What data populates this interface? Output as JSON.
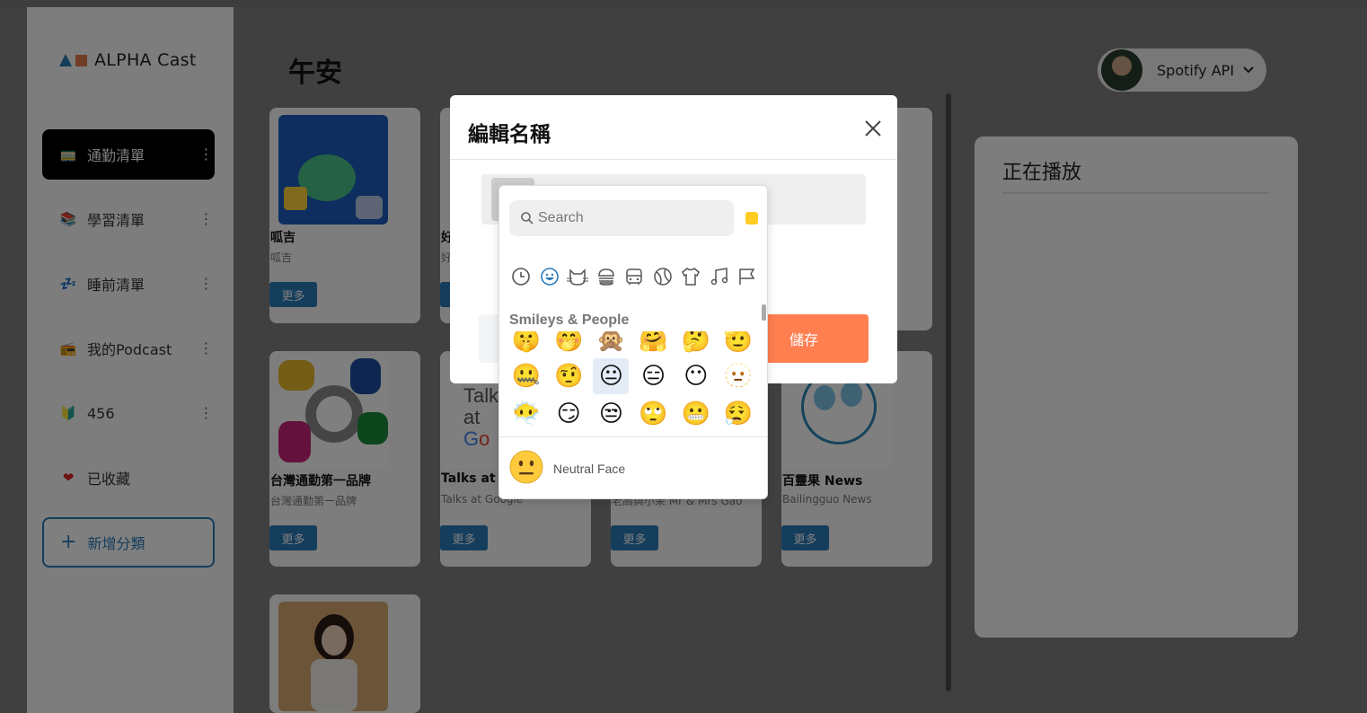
{
  "app": {
    "logo_text": "ALPHA Cast",
    "greeting": "午安"
  },
  "sidebar": {
    "items": [
      {
        "label": "通勤清單",
        "icon": "bus-icon",
        "glyph": "🚃",
        "active": true
      },
      {
        "label": "學習清單",
        "icon": "books-icon",
        "glyph": "📚",
        "active": false
      },
      {
        "label": "睡前清單",
        "icon": "sleep-icon",
        "glyph": "💤",
        "active": false
      },
      {
        "label": "我的Podcast",
        "icon": "radio-icon",
        "glyph": "📻",
        "active": false
      },
      {
        "label": "456",
        "icon": "beginner-icon",
        "glyph": "🔰",
        "active": false
      },
      {
        "label": "已收藏",
        "icon": "heart-icon",
        "glyph": "❤",
        "active": false
      }
    ],
    "add_category_label": "新增分類"
  },
  "user": {
    "name": "Spotify API"
  },
  "podcasts": [
    {
      "title": "呱吉",
      "subtitle": "呱吉",
      "more": "更多"
    },
    {
      "title": "好",
      "subtitle": "好",
      "more": "更多"
    },
    {
      "title": "台灣通勤第一品牌",
      "subtitle": "台灣通勤第一品牌",
      "more": "更多"
    },
    {
      "title": "Talks at G",
      "subtitle": "Talks at Google",
      "more": "更多"
    },
    {
      "title": "",
      "subtitle": "老高與小茉 Mr & Mrs Gao",
      "more": "更多"
    },
    {
      "title": "百靈果 News",
      "subtitle": "Bailingguo News",
      "more": "更多"
    }
  ],
  "now_playing": {
    "title": "正在播放"
  },
  "modal": {
    "title": "編輯名稱",
    "save_label": "儲存"
  },
  "emoji_picker": {
    "search_placeholder": "Search",
    "section_label": "Smileys & People",
    "preview_name": "Neutral Face",
    "rows": [
      [
        "🤫",
        "🤭",
        "🙊",
        "🤗",
        "🤔",
        "🫡"
      ],
      [
        "🤐",
        "🤨",
        "😐",
        "😑",
        "😶",
        "🫥"
      ],
      [
        "😶‍🌫️",
        "😏",
        "😒",
        "🙄",
        "😬",
        "😮‍💨"
      ]
    ],
    "categories": [
      "recent-icon",
      "smiley-icon",
      "cat-icon",
      "burger-icon",
      "bus-icon",
      "ball-icon",
      "shirt-icon",
      "music-icon",
      "flag-icon"
    ]
  }
}
